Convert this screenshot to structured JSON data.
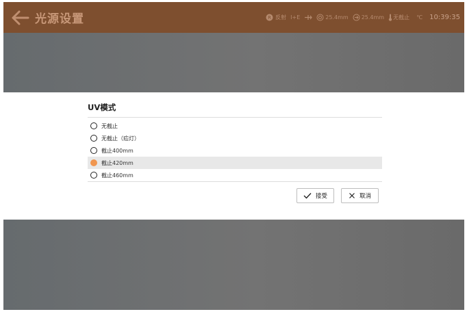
{
  "header": {
    "title": "光源设置",
    "status": {
      "r_badge": "R",
      "reflect": "反射",
      "lamp": "I+E",
      "indicator1": "25.4mm",
      "indicator2": "25.4mm",
      "uv_state": "无截止",
      "temp": "℃",
      "time": "10:39:35"
    }
  },
  "dialog": {
    "title": "UV模式",
    "options": [
      {
        "label": "无截止",
        "selected": false
      },
      {
        "label": "无截止（疝灯）",
        "selected": false
      },
      {
        "label": "截止400mm",
        "selected": false
      },
      {
        "label": "截止420mm",
        "selected": true
      },
      {
        "label": "截止460mm",
        "selected": false
      }
    ],
    "accept_label": "接受",
    "cancel_label": "取消"
  },
  "colors": {
    "header": "#7e4f2f",
    "accent": "#f09650",
    "overlay": "#6e6e6e"
  }
}
